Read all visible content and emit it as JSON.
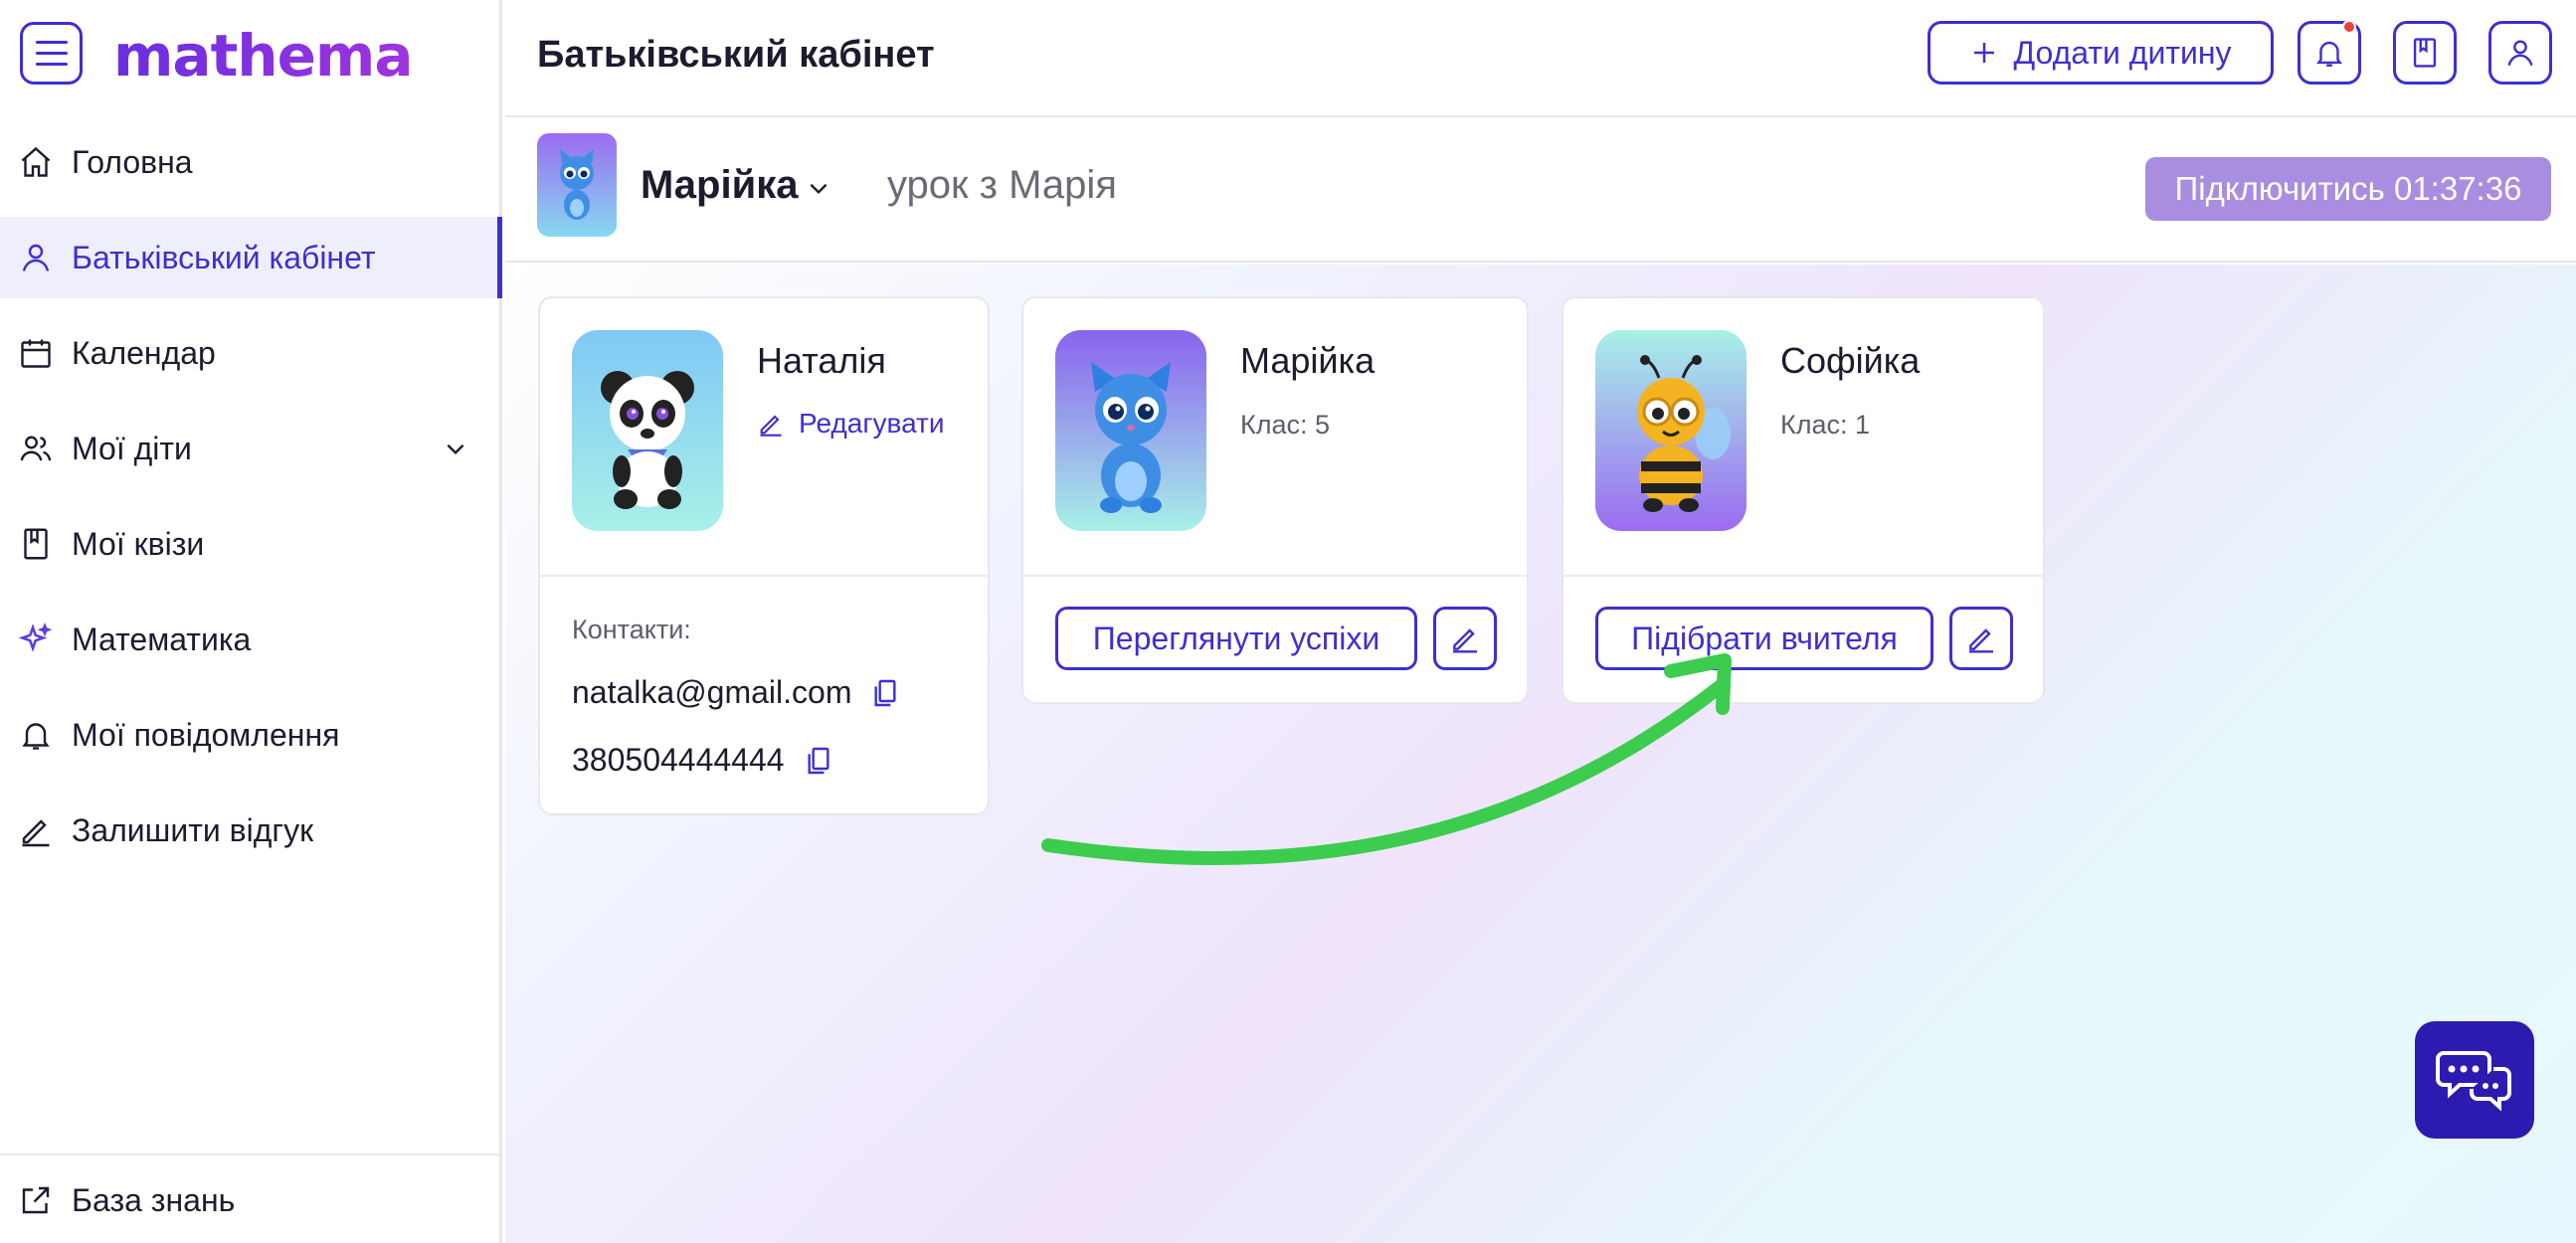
{
  "app": {
    "logo_text": "mathema",
    "accent": "#3d2fd0"
  },
  "sidebar": {
    "items": [
      {
        "label": "Головна",
        "icon": "home-icon",
        "active": false
      },
      {
        "label": "Батьківський кабінет",
        "icon": "user-icon",
        "active": true
      },
      {
        "label": "Календар",
        "icon": "calendar-icon",
        "active": false
      },
      {
        "label": "Мої діти",
        "icon": "children-icon",
        "active": false,
        "expandable": true
      },
      {
        "label": "Мої квізи",
        "icon": "book-icon",
        "active": false
      },
      {
        "label": "Математика",
        "icon": "sparkle-icon",
        "active": false
      },
      {
        "label": "Мої повідомлення",
        "icon": "bell-icon",
        "active": false
      },
      {
        "label": "Залишити відгук",
        "icon": "pencil-icon",
        "active": false
      }
    ],
    "bottom": {
      "label": "База знань",
      "icon": "external-link-icon"
    }
  },
  "header": {
    "title": "Батьківський кабінет",
    "add_child_label": "Додати дитину",
    "has_notification": true
  },
  "subheader": {
    "child_name": "Марійка",
    "lesson_text": "урок з Марія",
    "connect_label": "Підключитись 01:37:36"
  },
  "parent_card": {
    "name": "Наталія",
    "edit_label": "Редагувати",
    "contacts_label": "Контакти:",
    "email": "natalka@gmail.com",
    "phone": "380504444444",
    "avatar": "panda"
  },
  "child_cards": [
    {
      "name": "Марійка",
      "grade": "Клас: 5",
      "action_label": "Переглянути успіхи",
      "avatar": "blue-kitten"
    },
    {
      "name": "Софійка",
      "grade": "Клас: 1",
      "action_label": "Підібрати вчителя",
      "avatar": "bee"
    }
  ]
}
